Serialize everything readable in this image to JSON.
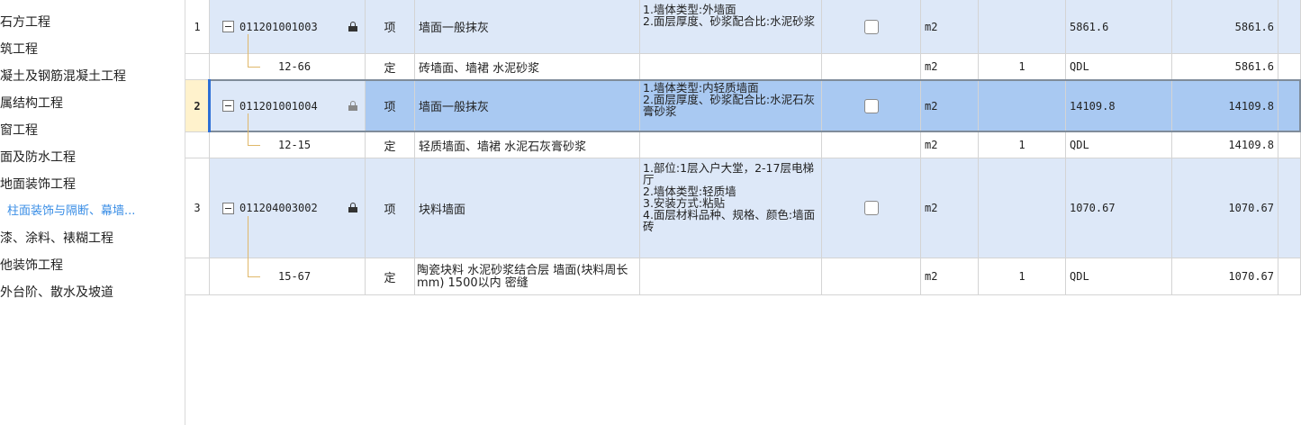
{
  "tree": {
    "items": [
      {
        "label": "石方工程",
        "active": false
      },
      {
        "label": "筑工程",
        "active": false
      },
      {
        "label": "凝土及钢筋混凝土工程",
        "active": false
      },
      {
        "label": "属结构工程",
        "active": false
      },
      {
        "label": "窗工程",
        "active": false
      },
      {
        "label": "面及防水工程",
        "active": false
      },
      {
        "label": "地面装饰工程",
        "active": false
      },
      {
        "label": "柱面装饰与隔断、幕墙...",
        "active": true
      },
      {
        "label": "漆、涂料、裱糊工程",
        "active": false
      },
      {
        "label": "他装饰工程",
        "active": false
      },
      {
        "label": "外台阶、散水及坡道",
        "active": false
      }
    ]
  },
  "rows": [
    {
      "num": "1",
      "code": "011201001003",
      "type": "项",
      "name": "墙面一般抹灰",
      "desc": "1.墙体类型:外墙面\n2.面层厚度、砂浆配合比:水泥砂浆",
      "unit": "m2",
      "coef": "",
      "expr": "5861.6",
      "qty": "5861.6"
    },
    {
      "code": "12-66",
      "type": "定",
      "name": "砖墙面、墙裙 水泥砂浆",
      "desc": "",
      "unit": "m2",
      "coef": "1",
      "expr": "QDL",
      "qty": "5861.6"
    },
    {
      "num": "2",
      "code": "011201001004",
      "type": "项",
      "name": "墙面一般抹灰",
      "desc": "1.墙体类型:内轻质墙面\n2.面层厚度、砂浆配合比:水泥石灰膏砂浆",
      "unit": "m2",
      "coef": "",
      "expr": "14109.8",
      "qty": "14109.8"
    },
    {
      "code": "12-15",
      "type": "定",
      "name": "轻质墙面、墙裙 水泥石灰膏砂浆",
      "desc": "",
      "unit": "m2",
      "coef": "1",
      "expr": "QDL",
      "qty": "14109.8"
    },
    {
      "num": "3",
      "code": "011204003002",
      "type": "项",
      "name": "块料墙面",
      "desc": "1.部位:1层入户大堂，2-17层电梯厅\n2.墙体类型:轻质墙\n3.安装方式:粘贴\n4.面层材料品种、规格、颜色:墙面砖",
      "unit": "m2",
      "coef": "",
      "expr": "1070.67",
      "qty": "1070.67"
    },
    {
      "code": "15-67",
      "type": "定",
      "name": "陶瓷块料 水泥砂浆结合层 墙面(块料周长mm) 1500以内 密缝",
      "desc": "",
      "unit": "m2",
      "coef": "1",
      "expr": "QDL",
      "qty": "1070.67"
    }
  ],
  "colors": {
    "item_row": "#dde8f8",
    "selected_row": "#a9c9f2",
    "selected_rownum": "#fff2cc",
    "tree_active": "#3a8ee6"
  }
}
